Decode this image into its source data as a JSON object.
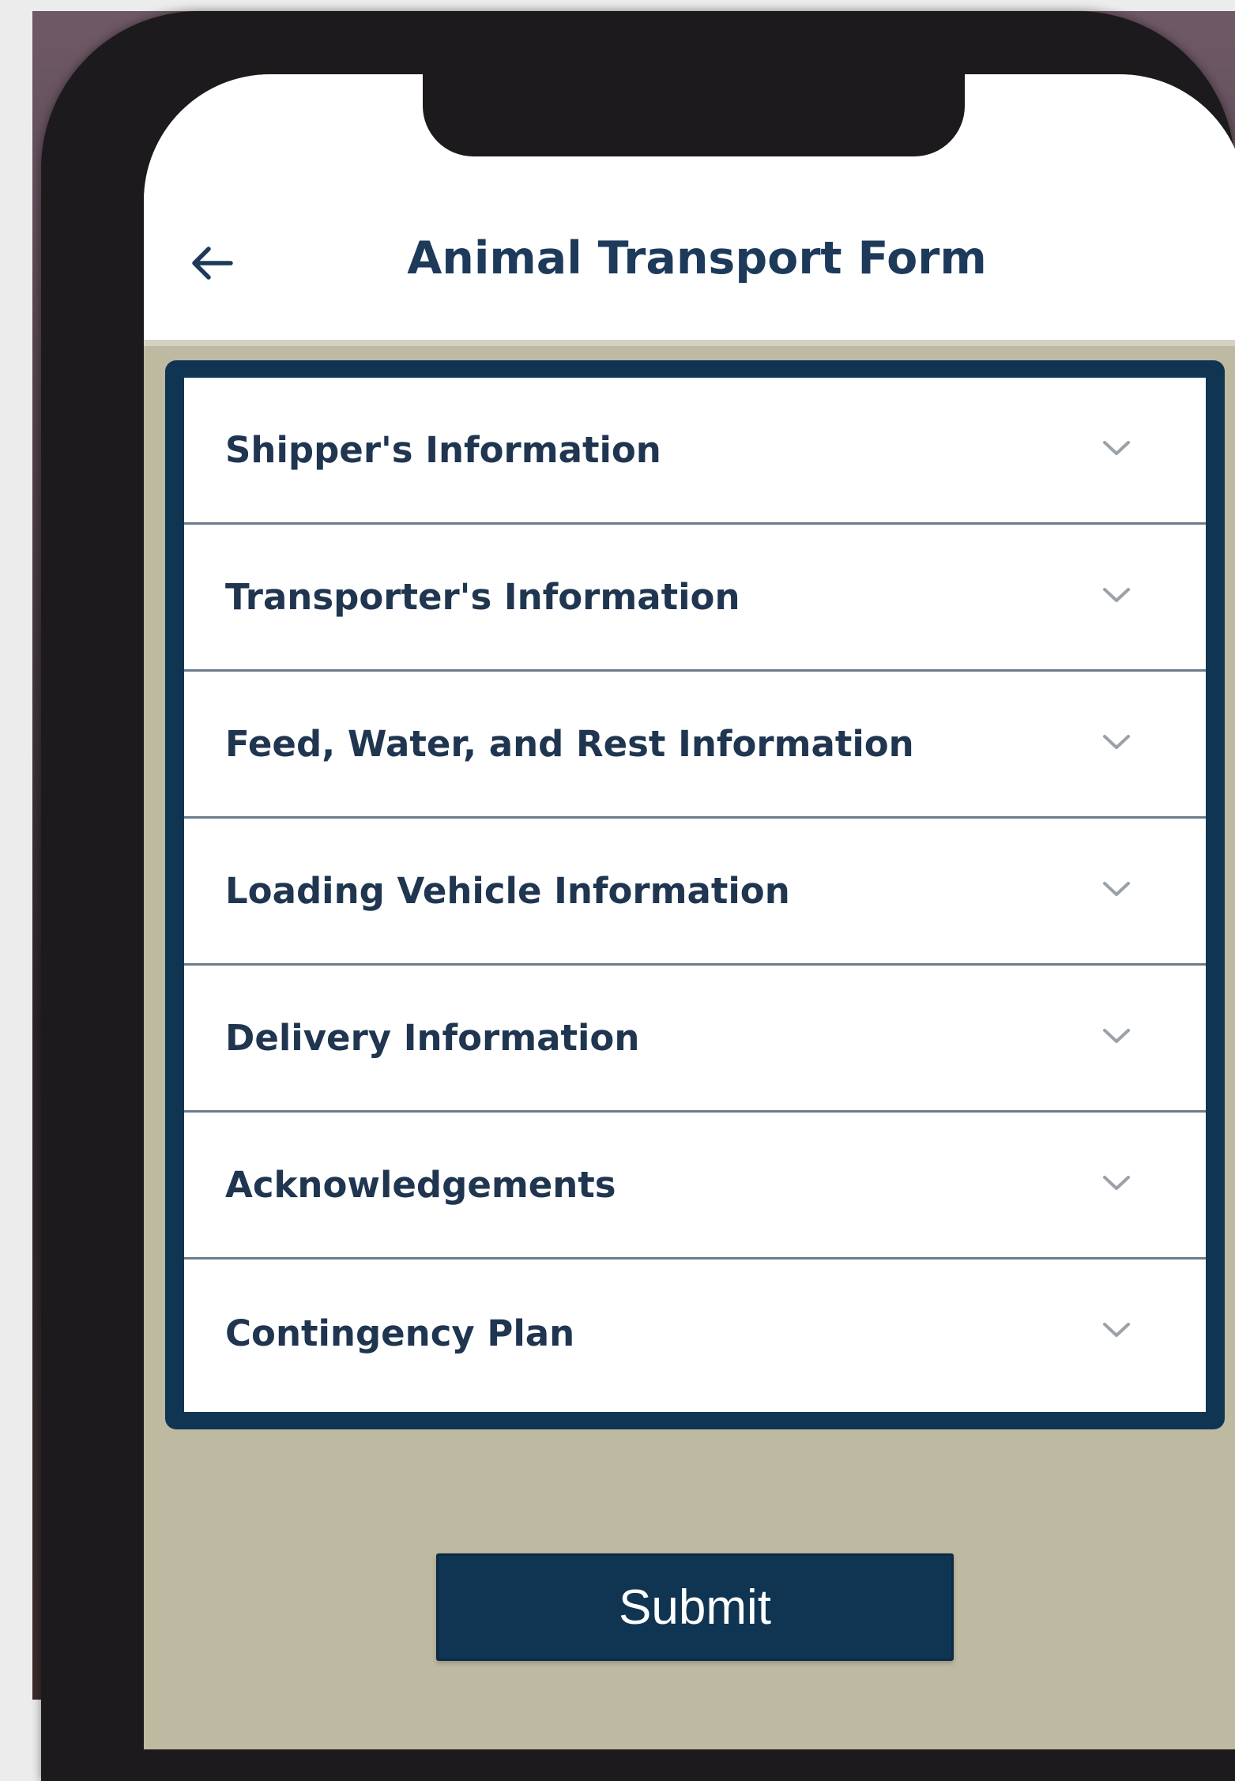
{
  "header": {
    "title": "Animal Transport Form",
    "back_icon": "arrow-left-icon"
  },
  "sections": [
    {
      "label": "Shipper's Information",
      "icon": "chevron-down-icon"
    },
    {
      "label": "Transporter's Information",
      "icon": "chevron-down-icon"
    },
    {
      "label": "Feed, Water, and Rest Information",
      "icon": "chevron-down-icon"
    },
    {
      "label": "Loading Vehicle Information",
      "icon": "chevron-down-icon"
    },
    {
      "label": "Delivery Information",
      "icon": "chevron-down-icon"
    },
    {
      "label": "Acknowledgements",
      "icon": "chevron-down-icon"
    },
    {
      "label": "Contingency Plan",
      "icon": "chevron-down-icon"
    }
  ],
  "actions": {
    "submit_label": "Submit"
  },
  "colors": {
    "primary": "#0f3553",
    "title_text": "#1d3a5a",
    "screen_background": "#beb9a1",
    "header_background": "#ffffff"
  }
}
